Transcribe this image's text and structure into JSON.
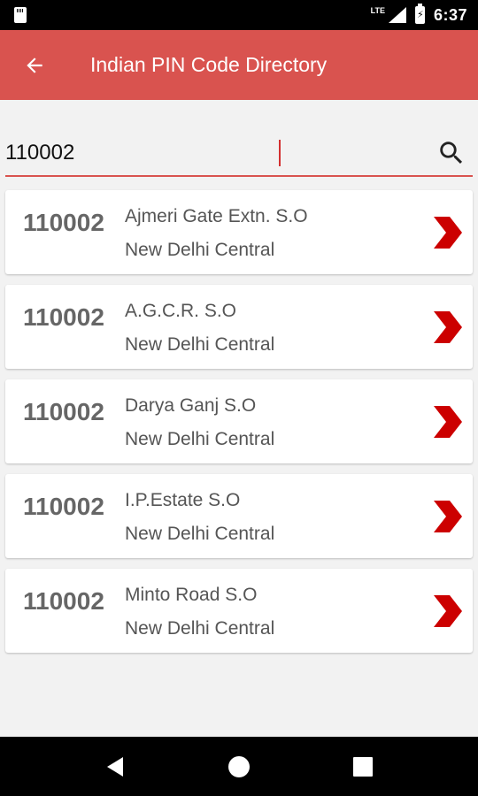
{
  "status_bar": {
    "time": "6:37",
    "network": "LTE",
    "battery_glyph": "⚡"
  },
  "app_bar": {
    "title": "Indian PIN Code Directory",
    "back_icon": "arrow-back-icon"
  },
  "search": {
    "value": "110002",
    "icon": "search-icon"
  },
  "results": [
    {
      "pin": "110002",
      "office": "Ajmeri Gate Extn. S.O",
      "district": "New Delhi Central"
    },
    {
      "pin": "110002",
      "office": "A.G.C.R. S.O",
      "district": "New Delhi Central"
    },
    {
      "pin": "110002",
      "office": "Darya Ganj S.O",
      "district": "New Delhi Central"
    },
    {
      "pin": "110002",
      "office": "I.P.Estate S.O",
      "district": "New Delhi Central"
    },
    {
      "pin": "110002",
      "office": "Minto Road S.O",
      "district": "New Delhi Central"
    }
  ],
  "colors": {
    "accent": "#d9534f",
    "chevron": "#cc0000"
  },
  "nav": {
    "back": "nav-back-icon",
    "home": "nav-home-icon",
    "recents": "nav-recents-icon"
  }
}
